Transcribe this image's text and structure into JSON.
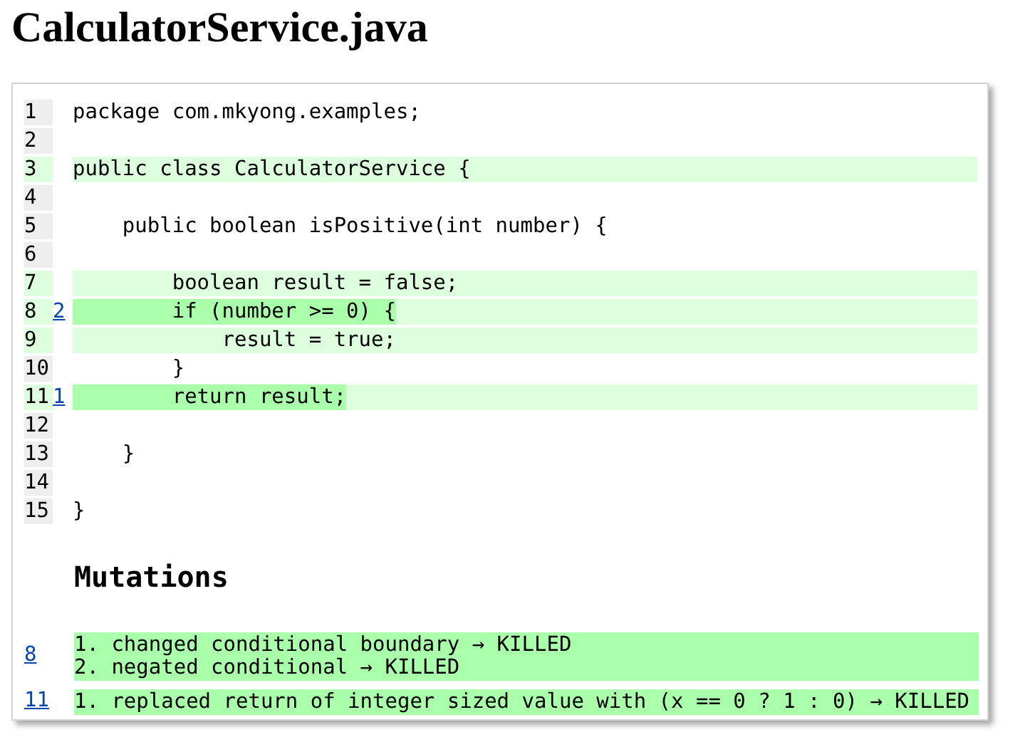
{
  "title": "CalculatorService.java",
  "lines": [
    {
      "number": "1",
      "kind": "plain",
      "code": "package com.mkyong.examples;"
    },
    {
      "number": "2",
      "kind": "plain"
    },
    {
      "number": "3",
      "kind": "covered",
      "code": "public class CalculatorService {"
    },
    {
      "number": "4",
      "kind": "plain"
    },
    {
      "number": "5",
      "kind": "plain",
      "code": "    public boolean isPositive(int number) {"
    },
    {
      "number": "6",
      "kind": "plain"
    },
    {
      "number": "7",
      "kind": "covered",
      "code": "        boolean result = false;"
    },
    {
      "number": "8",
      "kind": "killed",
      "mutations": "2",
      "code": "        if (number >= 0) {"
    },
    {
      "number": "9",
      "kind": "covered",
      "code": "            result = true;"
    },
    {
      "number": "10",
      "kind": "plain",
      "code": "        }"
    },
    {
      "number": "11",
      "kind": "killed",
      "mutations": "1",
      "code": "        return result;"
    },
    {
      "number": "12",
      "kind": "plain"
    },
    {
      "number": "13",
      "kind": "plain",
      "code": "    }"
    },
    {
      "number": "14",
      "kind": "plain"
    },
    {
      "number": "15",
      "kind": "plain",
      "code": "}"
    }
  ],
  "mutations_heading": "Mutations",
  "mutations": [
    {
      "line": "8",
      "items": [
        "1. changed conditional boundary → KILLED",
        "2. negated conditional → KILLED"
      ]
    },
    {
      "line": "11",
      "items": [
        "1. replaced return of integer sized value with (x == 0 ? 1 : 0) → KILLED"
      ]
    }
  ]
}
